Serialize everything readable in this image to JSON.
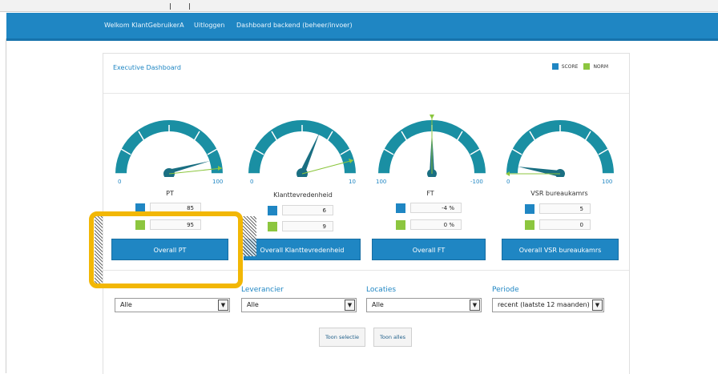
{
  "nav": {
    "welcome": "Welkom KlantGebruikerA",
    "logout": "Uitloggen",
    "backend": "Dashboard backend (beheer/invoer)"
  },
  "panel": {
    "title": "Executive Dashboard",
    "legend_score": "SCORE",
    "legend_norm": "NORM"
  },
  "colors": {
    "score": "#1f86c3",
    "norm": "#8cc63f",
    "gauge": "#1a8fa3"
  },
  "gauges": [
    {
      "label": "PT",
      "min": "0",
      "max": "100",
      "score": "85",
      "norm": "95",
      "button": "Overall PT"
    },
    {
      "label": "Klanttevredenheid",
      "min": "0",
      "max": "10",
      "score": "6",
      "norm": "9",
      "button": "Overall Klanttevredenheid"
    },
    {
      "label": "FT",
      "min": "100",
      "max": "-100",
      "score": "-4 %",
      "norm": "0 %",
      "button": "Overall FT"
    },
    {
      "label": "VSR bureaukamrs",
      "min": "0",
      "max": "100",
      "score": "5",
      "norm": "0",
      "button": "Overall VSR bureaukamrs"
    }
  ],
  "filters": [
    {
      "label": "",
      "value": "Alle"
    },
    {
      "label": "Leverancier",
      "value": "Alle"
    },
    {
      "label": "Locaties",
      "value": "Alle"
    },
    {
      "label": "Periode",
      "value": "recent (laatste 12 maanden)"
    }
  ],
  "buttons": {
    "toon_selectie": "Toon selectie",
    "toon_alles": "Toon alles"
  }
}
